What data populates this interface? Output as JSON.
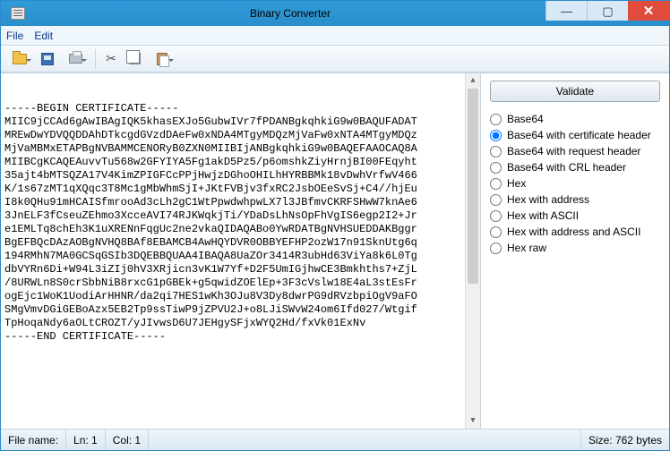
{
  "window": {
    "title": "Binary Converter"
  },
  "menubar": {
    "file": "File",
    "edit": "Edit"
  },
  "toolbar": {
    "open": "Open",
    "save": "Save",
    "print": "Print",
    "cut": "Cut",
    "copy": "Copy",
    "paste": "Paste"
  },
  "editor": {
    "lines": [
      "-----BEGIN CERTIFICATE-----",
      "MIIC9jCCAd6gAwIBAgIQK5khasEXJo5GubwIVr7fPDANBgkqhkiG9w0BAQUFADAT",
      "MREwDwYDVQQDDAhDTkcgdGVzdDAeFw0xNDA4MTgyMDQzMjVaFw0xNTA4MTgyMDQz",
      "MjVaMBMxETAPBgNVBAMMCENORyB0ZXN0MIIBIjANBgkqhkiG9w0BAQEFAAOCAQ8A",
      "MIIBCgKCAQEAuvvTu568w2GFYIYA5Fg1akD5Pz5/p6omshkZiyHrnjBI00FEqyht",
      "35ajt4bMTSQZA17V4KimZPIGFCcPPjHwjzDGhoOHILhHYRBBMk18vDwhVrfwV466",
      "K/1s67zMT1qXQqc3T8Mc1gMbWhmSjI+JKtFVBjv3fxRC2JsbOEeSvSj+C4//hjEu",
      "I8k0QHu91mHCAISfmrooAd3cLh2gC1WtPpwdwhpwLX7l3JBfmvCKRFSHwW7knAe6",
      "3JnELF3fCseuZEhmo3XcceAVI74RJKWqkjTi/YDaDsLhNsOpFhVgIS6egp2I2+Jr",
      "e1EMLTq8chEh3K1uXRENnFqgUc2ne2vkaQIDAQABo0YwRDATBgNVHSUEDDAKBggr",
      "BgEFBQcDAzAOBgNVHQ8BAf8EBAMCB4AwHQYDVR0OBBYEFHP2ozW17n91SknUtg6q",
      "194RMhN7MA0GCSqGSIb3DQEBBQUAA4IBAQA8UaZOr3414R3ubHd63ViYa8k6L0Tg",
      "dbVYRn6Di+W94L3iZIj0hV3XRjicn3vK1W7Yf+D2F5UmIGjhwCE3Bmkhths7+ZjL",
      "/8URWLn8S0crSbbNiB8rxcG1pGBEk+g5qwidZOElEp+3F3cVslw18E4aL3stEsFr",
      "ogEjc1WoK1UodiArHHNR/da2qi7HES1wKh3OJu8V3Dy8dwrPG9dRVzbpiOgV9aFO",
      "SMgVmvDGiGEBoAzx5EB2Tp9ssTiwP9jZPVU2J+o8LJiSWvW24om6Ifd027/Wtgif",
      "TpHoqaNdy6aOLtCROZT/yJIvwsD6U7JEHgySFjxWYQ2Hd/fxVk01ExNv",
      "-----END CERTIFICATE-----"
    ]
  },
  "sidepanel": {
    "validate": "Validate",
    "options": [
      {
        "label": "Base64",
        "selected": false
      },
      {
        "label": "Base64 with certificate header",
        "selected": true
      },
      {
        "label": "Base64 with request header",
        "selected": false
      },
      {
        "label": "Base64 with CRL header",
        "selected": false
      },
      {
        "label": "Hex",
        "selected": false
      },
      {
        "label": "Hex with address",
        "selected": false
      },
      {
        "label": "Hex with ASCII",
        "selected": false
      },
      {
        "label": "Hex with address and ASCII",
        "selected": false
      },
      {
        "label": "Hex raw",
        "selected": false
      }
    ]
  },
  "statusbar": {
    "filename_label": "File name:",
    "ln": "Ln: 1",
    "col": "Col: 1",
    "size": "Size: 762 bytes"
  }
}
